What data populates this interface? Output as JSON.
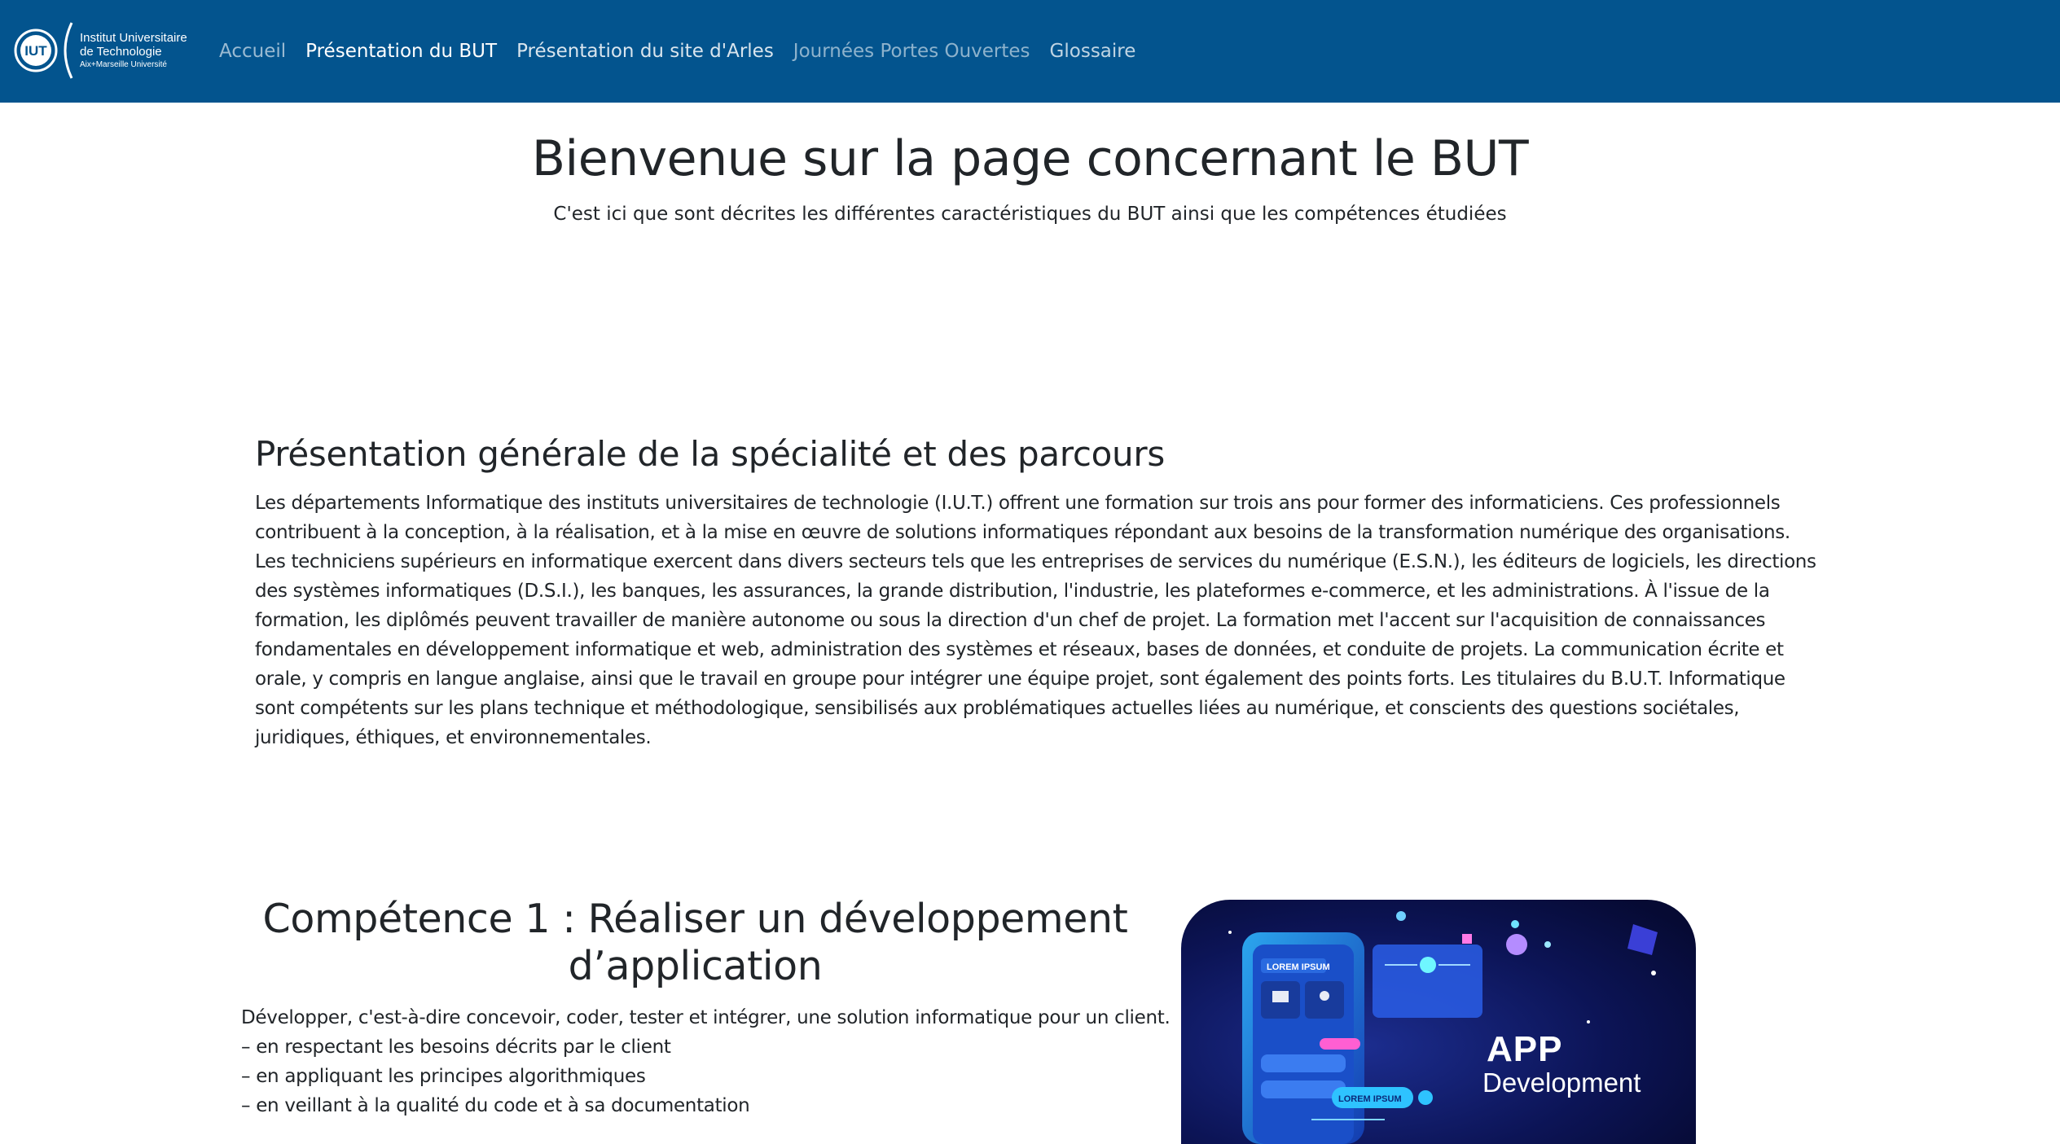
{
  "header": {
    "logo": {
      "mark_text": "IUT",
      "line1": "Institut Universitaire",
      "line2": "de Technologie",
      "line3": "Aix+Marseille Université"
    },
    "nav": [
      {
        "label": "Accueil",
        "active": false
      },
      {
        "label": "Présentation du BUT",
        "active": true
      },
      {
        "label": "Présentation du site d'Arles",
        "active": false
      },
      {
        "label": "Journées Portes Ouvertes",
        "active": false
      },
      {
        "label": "Glossaire",
        "active": false
      }
    ]
  },
  "hero": {
    "title": "Bienvenue sur la page concernant le BUT",
    "subtitle": "C'est ici que sont décrites les différentes caractéristiques du BUT ainsi que les compétences étudiées"
  },
  "presentation": {
    "title": "Présentation générale de la spécialité et des parcours",
    "body": "Les départements Informatique des instituts universitaires de technologie (I.U.T.) offrent une formation sur trois ans pour former des informaticiens. Ces professionnels contribuent à la conception, à la réalisation, et à la mise en œuvre de solutions informatiques répondant aux besoins de la transformation numérique des organisations. Les techniciens supérieurs en informatique exercent dans divers secteurs tels que les entreprises de services du numérique (E.S.N.), les éditeurs de logiciels, les directions des systèmes informatiques (D.S.I.), les banques, les assurances, la grande distribution, l'industrie, les plateformes e-commerce, et les administrations. À l'issue de la formation, les diplômés peuvent travailler de manière autonome ou sous la direction d'un chef de projet. La formation met l'accent sur l'acquisition de connaissances fondamentales en développement informatique et web, administration des systèmes et réseaux, bases de données, et conduite de projets. La communication écrite et orale, y compris en langue anglaise, ainsi que le travail en groupe pour intégrer une équipe projet, sont également des points forts. Les titulaires du B.U.T. Informatique sont compétents sur les plans technique et méthodologique, sensibilisés aux problématiques actuelles liées au numérique, et conscients des questions sociétales, juridiques, éthiques, et environnementales."
  },
  "competence1": {
    "title": "Compétence 1 : Réaliser un développement d’application",
    "intro": "Développer, c'est-à-dire concevoir, coder, tester et intégrer, une solution informatique pour un client.",
    "items": [
      "– en respectant les besoins décrits par le client",
      "– en appliquant les principes algorithmiques",
      "– en veillant à la qualité du code et à sa documentation"
    ],
    "image": {
      "app_word": "APP",
      "dev_word": "Development",
      "lorem1": "LOREM IPSUM",
      "lorem2": "LOREM IPSUM"
    }
  }
}
